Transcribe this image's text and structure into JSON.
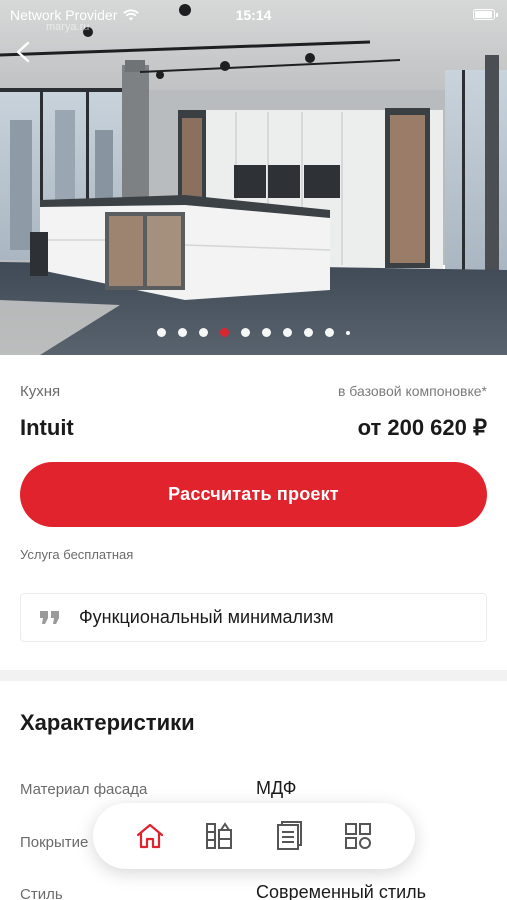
{
  "status_bar": {
    "carrier": "Network Provider",
    "time": "15:14",
    "battery_level": 1.0
  },
  "hero": {
    "watermark": "marya.ru",
    "slides_total": 10,
    "active_slide": 4
  },
  "product": {
    "category": "Кухня",
    "base_note": "в базовой компоновке*",
    "name": "Intuit",
    "price": "от 200 620 ₽"
  },
  "cta_label": "Рассчитать проект",
  "free_note": "Услуга бесплатная",
  "quote": "Функциональный минимализм",
  "specs": {
    "title": "Характеристики",
    "rows": [
      {
        "label": "Материал фасада",
        "value": "МДФ"
      },
      {
        "label": "Покрытие",
        "value": ""
      },
      {
        "label": "Стиль",
        "value": "Современный стиль"
      }
    ]
  },
  "tabbar": {
    "active": "home",
    "items": [
      "home-icon",
      "catalog-icon",
      "document-icon",
      "grid-icon"
    ]
  },
  "colors": {
    "accent": "#e1232e",
    "text": "#1a1a1a",
    "muted": "#6b6b6b"
  }
}
